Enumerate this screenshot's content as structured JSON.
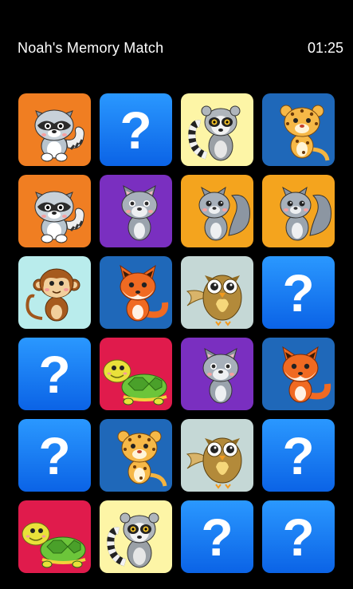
{
  "header": {
    "title": "Noah's Memory Match",
    "timer": "01:25"
  },
  "hidden_symbol": "?",
  "colors": {
    "hidden_card_top": "#2a98ff",
    "hidden_card_bottom": "#0b63e6",
    "background": "#000000"
  },
  "cards": [
    {
      "state": "revealed",
      "animal": "raccoon",
      "bg": "#f07e22"
    },
    {
      "state": "hidden"
    },
    {
      "state": "revealed",
      "animal": "lemur",
      "bg": "#fdf5a6"
    },
    {
      "state": "revealed",
      "animal": "leopard",
      "bg": "#1f68b9"
    },
    {
      "state": "revealed",
      "animal": "raccoon",
      "bg": "#f07e22"
    },
    {
      "state": "revealed",
      "animal": "wolf",
      "bg": "#7a2fc0"
    },
    {
      "state": "revealed",
      "animal": "squirrel",
      "bg": "#f4a41e"
    },
    {
      "state": "revealed",
      "animal": "squirrel",
      "bg": "#f4a41e"
    },
    {
      "state": "revealed",
      "animal": "monkey",
      "bg": "#b9ecec"
    },
    {
      "state": "revealed",
      "animal": "fox",
      "bg": "#1f68b9"
    },
    {
      "state": "revealed",
      "animal": "owl",
      "bg": "#c5d8d6"
    },
    {
      "state": "hidden"
    },
    {
      "state": "hidden"
    },
    {
      "state": "revealed",
      "animal": "turtle",
      "bg": "#e01b4c"
    },
    {
      "state": "revealed",
      "animal": "wolf",
      "bg": "#7a2fc0"
    },
    {
      "state": "revealed",
      "animal": "fox",
      "bg": "#1f68b9"
    },
    {
      "state": "hidden"
    },
    {
      "state": "revealed",
      "animal": "leopard",
      "bg": "#1f68b9"
    },
    {
      "state": "revealed",
      "animal": "owl",
      "bg": "#c5d8d6"
    },
    {
      "state": "hidden"
    },
    {
      "state": "revealed",
      "animal": "turtle",
      "bg": "#e01b4c"
    },
    {
      "state": "revealed",
      "animal": "lemur",
      "bg": "#fdf5a6"
    },
    {
      "state": "hidden"
    },
    {
      "state": "hidden"
    }
  ]
}
